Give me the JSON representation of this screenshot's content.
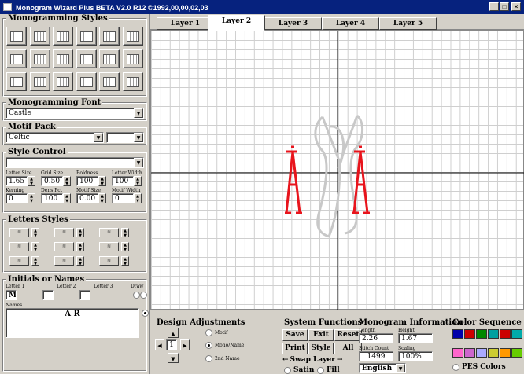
{
  "window": {
    "title": "Monogram Wizard Plus BETA V2.0 R12 ©1992,00,00,02,03",
    "minimize": "_",
    "maximize": "□",
    "close": "×"
  },
  "tabs": [
    "Layer 1",
    "Layer 2",
    "Layer 3",
    "Layer 4",
    "Layer 5"
  ],
  "active_tab": "Layer 2",
  "left": {
    "styles_title": "Monogramming Styles",
    "font_title": "Monogramming Font",
    "font_value": "Castle",
    "motif_title": "Motif Pack",
    "motif_value": "Celtic",
    "motif_value2": "",
    "style_control_title": "Style Control",
    "style_control_value": "",
    "params": {
      "letter_size_label": "Letter Size",
      "letter_size": "1.65",
      "grid_size_label": "Grid Size",
      "grid_size": "0.50",
      "boldness_label": "Boldness",
      "boldness": "100",
      "letter_width_label": "Letter Width",
      "letter_width": "100",
      "kerning_label": "Kerning",
      "kerning": "0",
      "dens_pct_label": "Dens Pct",
      "dens_pct": "100",
      "motif_size_label": "Motif Size",
      "motif_size": "0.00",
      "motif_width_label": "Motif Width",
      "motif_width": "0"
    },
    "letters_styles_title": "Letters Styles",
    "initials_title": "Initials or Names",
    "letter1_label": "Letter 1",
    "letter1": "M",
    "letter2_label": "Letter 2",
    "letter2": "",
    "letter3_label": "Letter 3",
    "letter3": "",
    "draw_label": "Draw",
    "names_label": "Names",
    "names_value": "A R"
  },
  "bottom": {
    "design_title": "Design Adjustments",
    "opt_motif": "Motif",
    "opt_mono": "Mono/Name",
    "opt_2nd": "2nd Name",
    "stepper_value": "1",
    "sys_title": "System Functions",
    "save": "Save",
    "exit": "Exit",
    "reset": "Reset",
    "print": "Print",
    "style": "Style",
    "all": "All",
    "swap_left": "←",
    "swap_label": "Swap Layer",
    "swap_right": "→",
    "satin": "Satin",
    "fill": "Fill",
    "info_title": "Monogram Information",
    "length_label": "Length",
    "length": "2.26",
    "height_label": "Height",
    "height": "1.67",
    "stitch_label": "Stitch Count",
    "stitch": "1499",
    "scaling_label": "Scaling",
    "scaling": "100%",
    "language": "English",
    "color_title": "Color Sequence",
    "pes": "PES Colors"
  },
  "colors": {
    "swatch_row1": [
      "#0000aa",
      "#cc0000",
      "#008800",
      "#00a0a0",
      "#cc0000",
      "#00aaaa"
    ],
    "swatch_row2": [
      "#ff66cc",
      "#cc66cc",
      "#aaaaff",
      "#cccc33",
      "#ff9900",
      "#66cc00"
    ],
    "monogram_red": "#e8141c",
    "monogram_gray": "#d0d0d0"
  }
}
